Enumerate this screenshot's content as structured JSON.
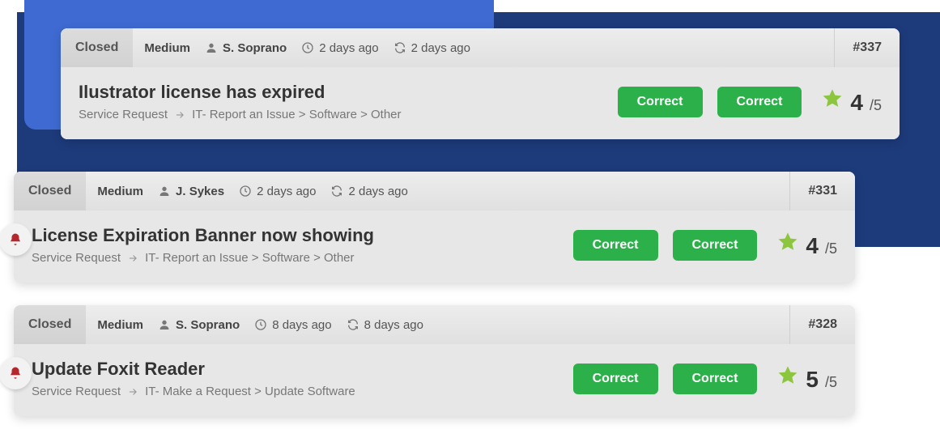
{
  "tickets": [
    {
      "status": "Closed",
      "priority": "Medium",
      "user": "S. Soprano",
      "created": "2 days ago",
      "updated": "2 days ago",
      "id": "#337",
      "title": "Ilustrator license has expired",
      "request_type": "Service Request",
      "category_path": "IT- Report an Issue > Software > Other",
      "btn1": "Correct",
      "btn2": "Correct",
      "rating": "4",
      "rating_out": "/5",
      "has_bell": false
    },
    {
      "status": "Closed",
      "priority": "Medium",
      "user": "J. Sykes",
      "created": "2 days ago",
      "updated": "2 days ago",
      "id": "#331",
      "title": "License Expiration Banner now showing",
      "request_type": "Service Request",
      "category_path": "IT- Report an Issue > Software > Other",
      "btn1": "Correct",
      "btn2": "Correct",
      "rating": "4",
      "rating_out": "/5",
      "has_bell": true
    },
    {
      "status": "Closed",
      "priority": "Medium",
      "user": "S. Soprano",
      "created": "8 days ago",
      "updated": "8 days ago",
      "id": "#328",
      "title": "Update Foxit Reader",
      "request_type": "Service Request",
      "category_path": "IT- Make a Request > Update Software",
      "btn1": "Correct",
      "btn2": "Correct",
      "rating": "5",
      "rating_out": "/5",
      "has_bell": true
    }
  ],
  "colors": {
    "blue_box": "#3e6ad1",
    "blue_strip": "#1d3a7a",
    "green_btn": "#2cb14a",
    "star": "#8cc63f",
    "bell": "#b3272d"
  }
}
